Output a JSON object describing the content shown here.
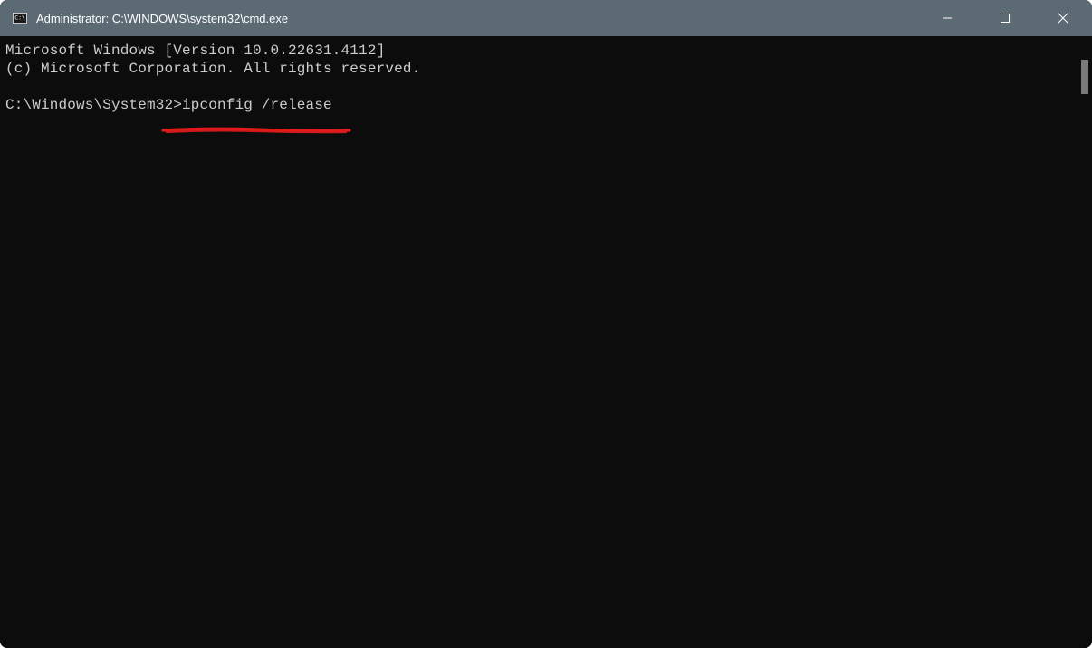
{
  "window": {
    "title": "Administrator: C:\\WINDOWS\\system32\\cmd.exe"
  },
  "terminal": {
    "line1": "Microsoft Windows [Version 10.0.22631.4112]",
    "line2": "(c) Microsoft Corporation. All rights reserved.",
    "blank": "",
    "prompt": "C:\\Windows\\System32>",
    "command": "ipconfig /release"
  },
  "annotation": {
    "color": "#e11b1b"
  }
}
